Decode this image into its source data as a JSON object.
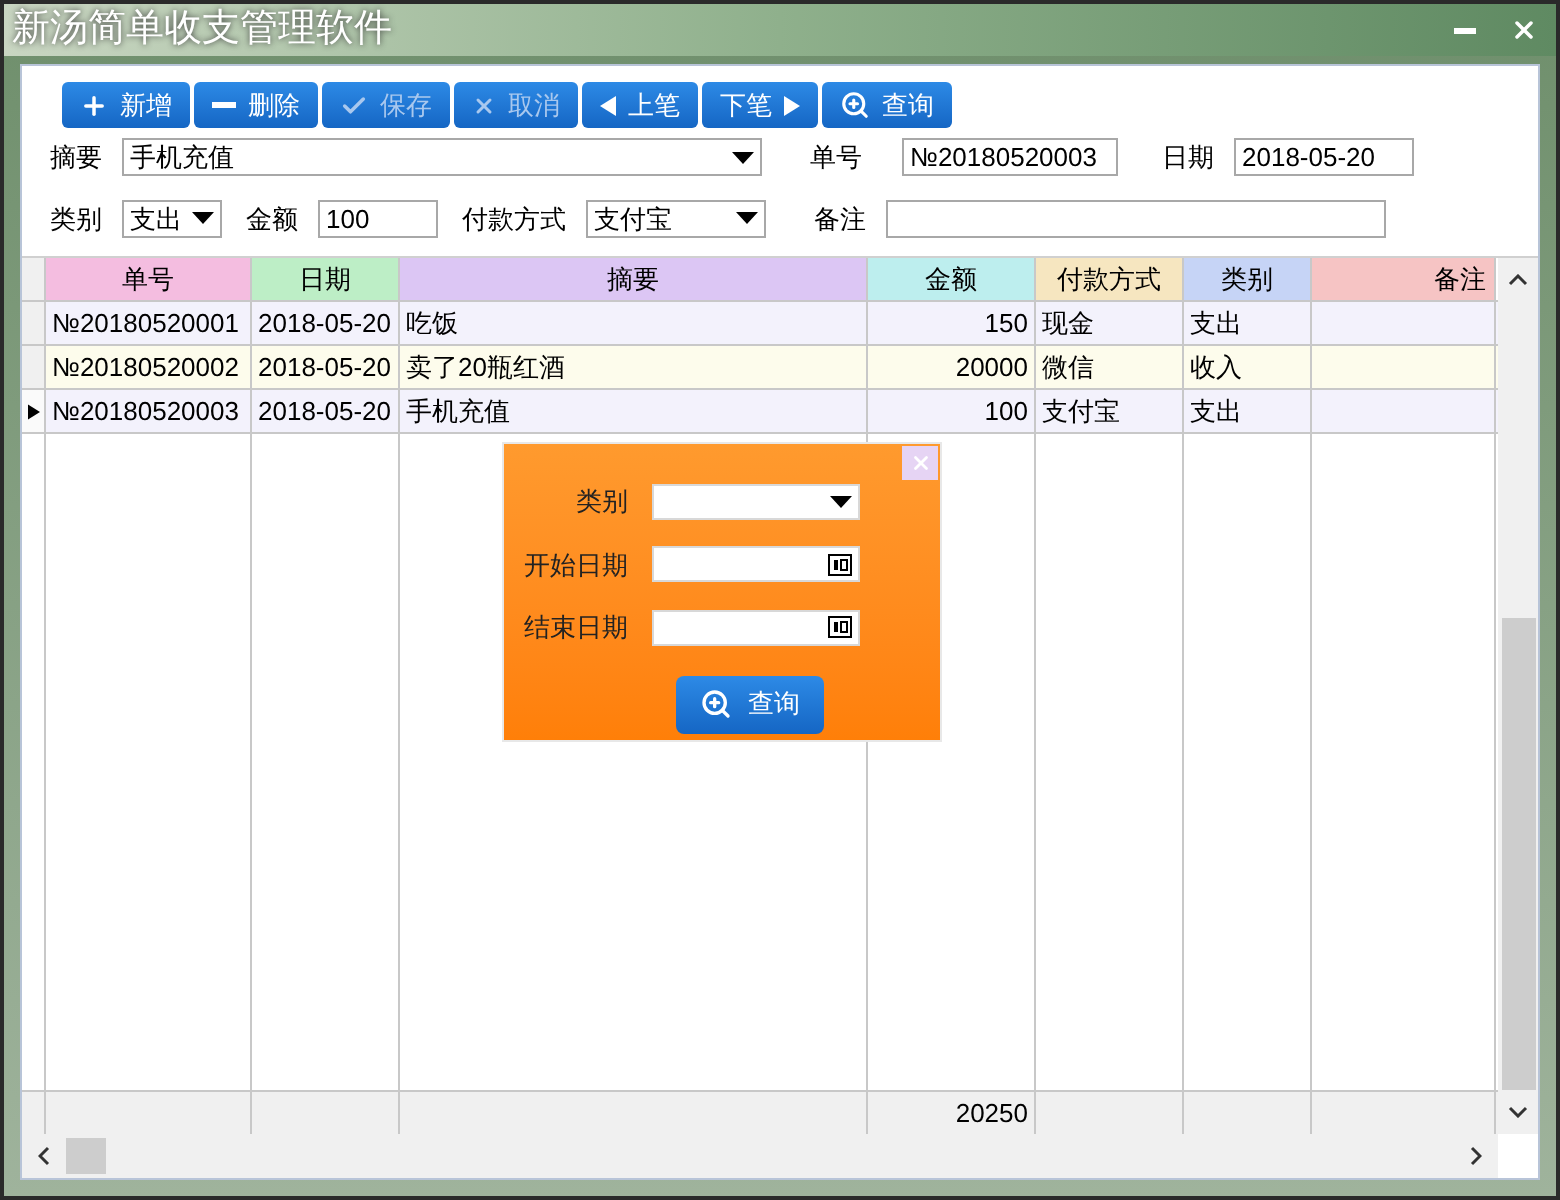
{
  "window": {
    "title": "新汤简单收支管理软件"
  },
  "toolbar": [
    {
      "label": "新增",
      "kind": "plus",
      "disabled": false
    },
    {
      "label": "删除",
      "kind": "minus",
      "disabled": false
    },
    {
      "label": "保存",
      "kind": "check",
      "disabled": true
    },
    {
      "label": "取消",
      "kind": "x",
      "disabled": true
    },
    {
      "label": "上笔",
      "kind": "prev",
      "disabled": false
    },
    {
      "label": "下笔",
      "kind": "next",
      "disabled": false
    },
    {
      "label": "查询",
      "kind": "search",
      "disabled": false
    }
  ],
  "form_rows": [
    [
      {
        "label": "摘要",
        "kind": "select",
        "value": "手机充值"
      },
      {
        "label": "单号",
        "kind": "input",
        "value": "№20180520003"
      },
      {
        "label": "日期",
        "kind": "input",
        "value": "2018-05-20"
      }
    ],
    [
      {
        "label": "类别",
        "kind": "select",
        "value": "支出"
      },
      {
        "label": "金额",
        "kind": "input",
        "value": "100"
      },
      {
        "label": "付款方式",
        "kind": "select",
        "value": "支付宝"
      },
      {
        "label": "备注",
        "kind": "input"
      }
    ]
  ],
  "table": {
    "columns": [
      {
        "label": "单号",
        "color": "#f4bde0"
      },
      {
        "label": "日期",
        "color": "#bdeec6"
      },
      {
        "label": "摘要",
        "color": "#dcc6f4"
      },
      {
        "label": "金额",
        "color": "#bdeeee"
      },
      {
        "label": "付款方式",
        "color": "#f6e6c0"
      },
      {
        "label": "类别",
        "color": "#c6d4f6"
      },
      {
        "label": "备注",
        "color": "#f6c4c4"
      }
    ],
    "rows": [
      {
        "cells": [
          "№20180520001",
          "2018-05-20",
          "吃饭",
          "150",
          "现金",
          "支出"
        ],
        "selected": false
      },
      {
        "cells": [
          "№20180520002",
          "2018-05-20",
          "卖了20瓶红酒",
          "20000",
          "微信",
          "收入"
        ],
        "selected": false
      },
      {
        "cells": [
          "№20180520003",
          "2018-05-20",
          "手机充值",
          "100",
          "支付宝",
          "支出"
        ],
        "selected": true
      }
    ],
    "total": "20250"
  },
  "query_dialog": {
    "fields": [
      {
        "label": "类别",
        "kind": "select"
      },
      {
        "label": "开始日期",
        "kind": "date"
      },
      {
        "label": "结束日期",
        "kind": "date"
      }
    ],
    "button": "查询"
  }
}
